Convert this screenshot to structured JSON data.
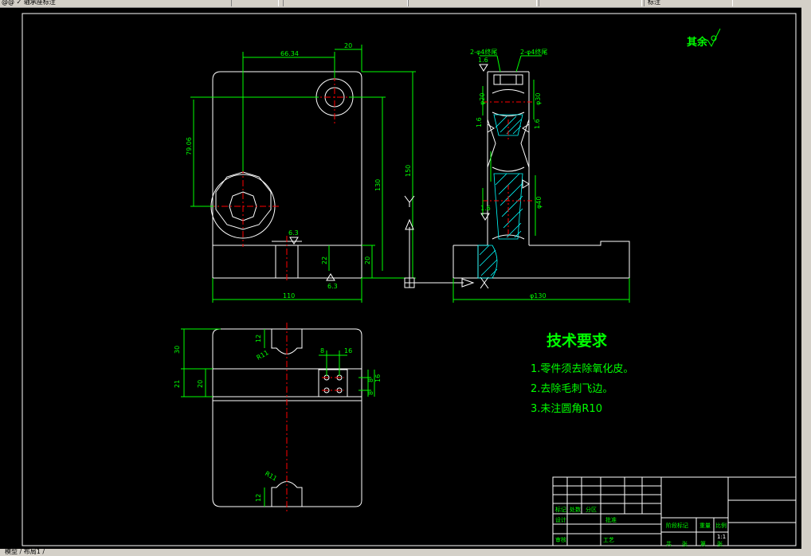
{
  "toolbar": {
    "left_text": "@@ ✓ 轴承座标注",
    "right_text": "标注"
  },
  "status": {
    "text": "模型 / 布局1 /"
  },
  "roughness_note": "其余",
  "dims": {
    "d1": "66.34",
    "d2": "20",
    "d3": "79.06",
    "d4": "150",
    "d5": "130",
    "d6": "6.3",
    "d7": "22",
    "d8": "20",
    "d9": "110",
    "d10": "6.3",
    "s1": "2-φ4终尾",
    "s2": "2-φ4终尾",
    "s3": "1.6",
    "s4": "φ20",
    "s5": "φ30",
    "s6": "1.6",
    "s7": "1.6",
    "s8": "1.6",
    "s9": "φ40",
    "s10": "φ130",
    "b1": "30",
    "b2": "12",
    "b3": "21",
    "b4": "20",
    "b5": "R11",
    "b6": "8",
    "b7": "16",
    "b8": "8",
    "b9": "16",
    "b10": "8",
    "b11": "12",
    "b12": "R11"
  },
  "tech": {
    "title": "技术要求",
    "items": [
      "1.零件须去除氧化皮。",
      "2.去除毛刺飞边。",
      "3.未注圆角R10"
    ]
  },
  "title_block": {
    "labels": [
      "标记",
      "处数",
      "分区",
      "设计",
      "审核",
      "工艺",
      "批准",
      "共",
      "张",
      "第",
      "张",
      "重量",
      "比例",
      "阶段标记"
    ],
    "scale": "1:1"
  },
  "colors": {
    "line": "#ffffff",
    "dim": "#00ff00",
    "center": "#ff0000",
    "hatch": "#00ffff",
    "symbol": "#ffffff"
  }
}
